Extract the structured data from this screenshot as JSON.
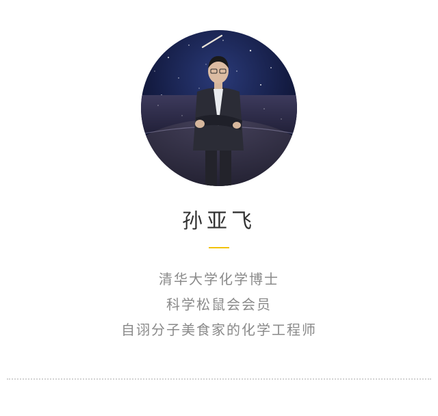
{
  "profile": {
    "name": "孙亚飞",
    "bio": [
      "清华大学化学博士",
      "科学松鼠会会员",
      "自诩分子美食家的化学工程师"
    ],
    "accent_color": "#f2c200"
  }
}
